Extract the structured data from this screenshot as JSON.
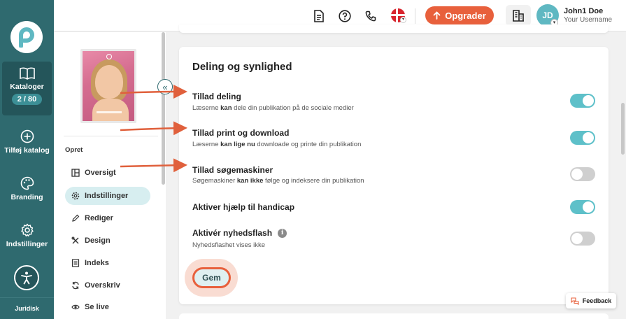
{
  "rail": {
    "items": [
      {
        "label": "Kataloger",
        "count": "2 / 80"
      },
      {
        "label": "Tilføj katalog"
      },
      {
        "label": "Branding"
      },
      {
        "label": "Indstillinger"
      }
    ],
    "footer_label": "Juridisk"
  },
  "topbar": {
    "upgrade_label": "Opgrader",
    "avatar_initials": "JD",
    "user_name": "John1 Doe",
    "user_sub": "Your Username"
  },
  "subnav": {
    "heading": "Opret",
    "items": [
      {
        "label": "Oversigt",
        "icon": "layout-icon"
      },
      {
        "label": "Indstillinger",
        "icon": "gear-icon"
      },
      {
        "label": "Rediger",
        "icon": "pencil-icon"
      },
      {
        "label": "Design",
        "icon": "tools-icon"
      },
      {
        "label": "Indeks",
        "icon": "list-icon"
      },
      {
        "label": "Overskriv",
        "icon": "refresh-icon"
      },
      {
        "label": "Se live",
        "icon": "eye-icon"
      }
    ]
  },
  "card": {
    "title": "Deling og synlighed",
    "settings": [
      {
        "title": "Tillad deling",
        "desc_pre": "Læserne ",
        "desc_bold": "kan",
        "desc_post": " dele din publikation på de sociale medier",
        "on": true
      },
      {
        "title": "Tillad print og download",
        "desc_pre": "Læserne ",
        "desc_bold": "kan lige nu",
        "desc_post": " downloade og printe din publikation",
        "on": true
      },
      {
        "title": "Tillad søgemaskiner",
        "desc_pre": "Søgemaskiner ",
        "desc_bold": "kan ikke",
        "desc_post": " følge og indeksere din publikation",
        "on": false
      },
      {
        "title": "Aktiver hjælp til handicap",
        "on": true
      },
      {
        "title": "Aktivér nyhedsflash",
        "desc_pre": "Nyhedsflashet vises ikke",
        "on": false
      }
    ],
    "save_label": "Gem",
    "info_glyph": "i"
  },
  "feedback_label": "Feedback",
  "colors": {
    "rail": "#2f6a6f",
    "accent": "#e8603c",
    "toggle_on": "#5ec0c9",
    "toggle_off": "#cfcfcf"
  }
}
